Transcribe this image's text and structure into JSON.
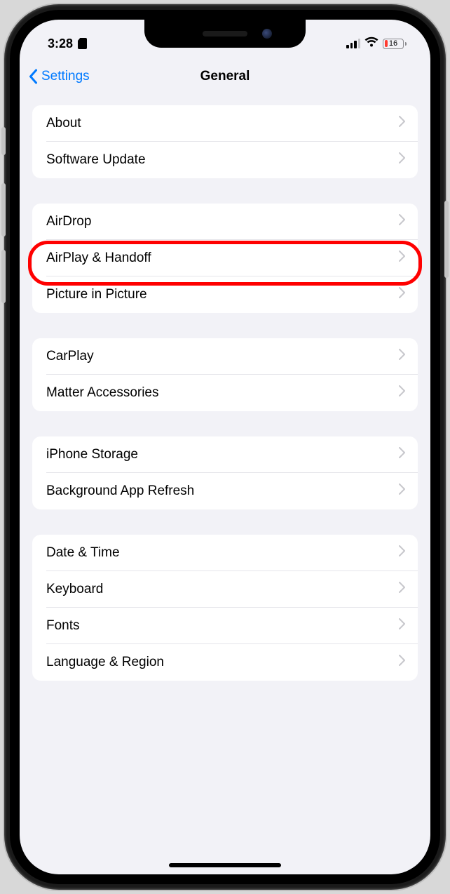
{
  "status": {
    "time": "3:28",
    "battery_percent": "16"
  },
  "nav": {
    "back_label": "Settings",
    "title": "General"
  },
  "groups": [
    {
      "rows": [
        {
          "label": "About"
        },
        {
          "label": "Software Update"
        }
      ]
    },
    {
      "highlight_index": 1,
      "rows": [
        {
          "label": "AirDrop"
        },
        {
          "label": "AirPlay & Handoff"
        },
        {
          "label": "Picture in Picture"
        }
      ]
    },
    {
      "rows": [
        {
          "label": "CarPlay"
        },
        {
          "label": "Matter Accessories"
        }
      ]
    },
    {
      "rows": [
        {
          "label": "iPhone Storage"
        },
        {
          "label": "Background App Refresh"
        }
      ]
    },
    {
      "rows": [
        {
          "label": "Date & Time"
        },
        {
          "label": "Keyboard"
        },
        {
          "label": "Fonts"
        },
        {
          "label": "Language & Region"
        }
      ]
    }
  ]
}
